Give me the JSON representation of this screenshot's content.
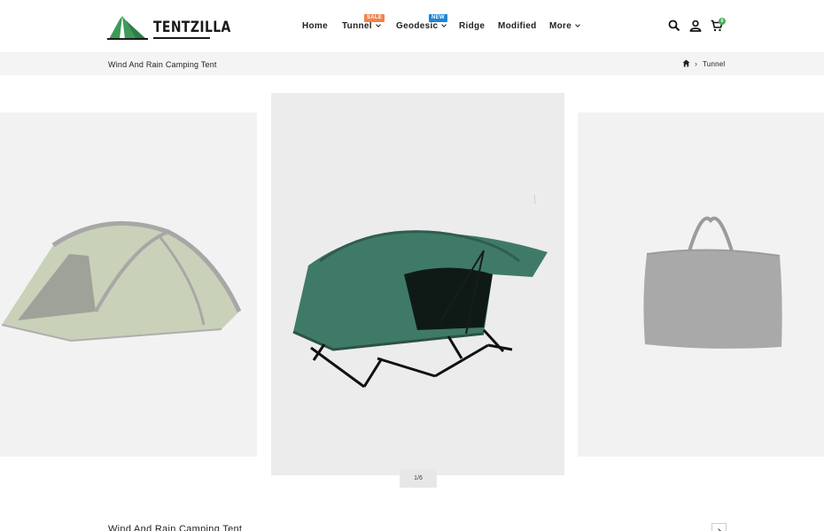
{
  "brand": {
    "name": "TENTZILLA"
  },
  "nav": {
    "items": [
      {
        "label": "Home"
      },
      {
        "label": "Tunnel",
        "badge": "SALE"
      },
      {
        "label": "Geodesic",
        "badge": "NEW"
      },
      {
        "label": "Ridge"
      },
      {
        "label": "Modified"
      },
      {
        "label": "More"
      }
    ]
  },
  "header": {
    "cart_count": "0",
    "icons": [
      "search-icon",
      "account-icon",
      "cart-icon"
    ]
  },
  "breadcrumb": {
    "page_title": "Wind And Rain Camping Tent",
    "current": "Tunnel"
  },
  "gallery": {
    "pager": "1/6"
  },
  "product": {
    "title": "Wind And Rain Camping Tent"
  },
  "colors": {
    "accent_green": "#4bae5a",
    "sale": "#f0834a",
    "new": "#1b87d6",
    "tent_green": "#3f7a68"
  }
}
